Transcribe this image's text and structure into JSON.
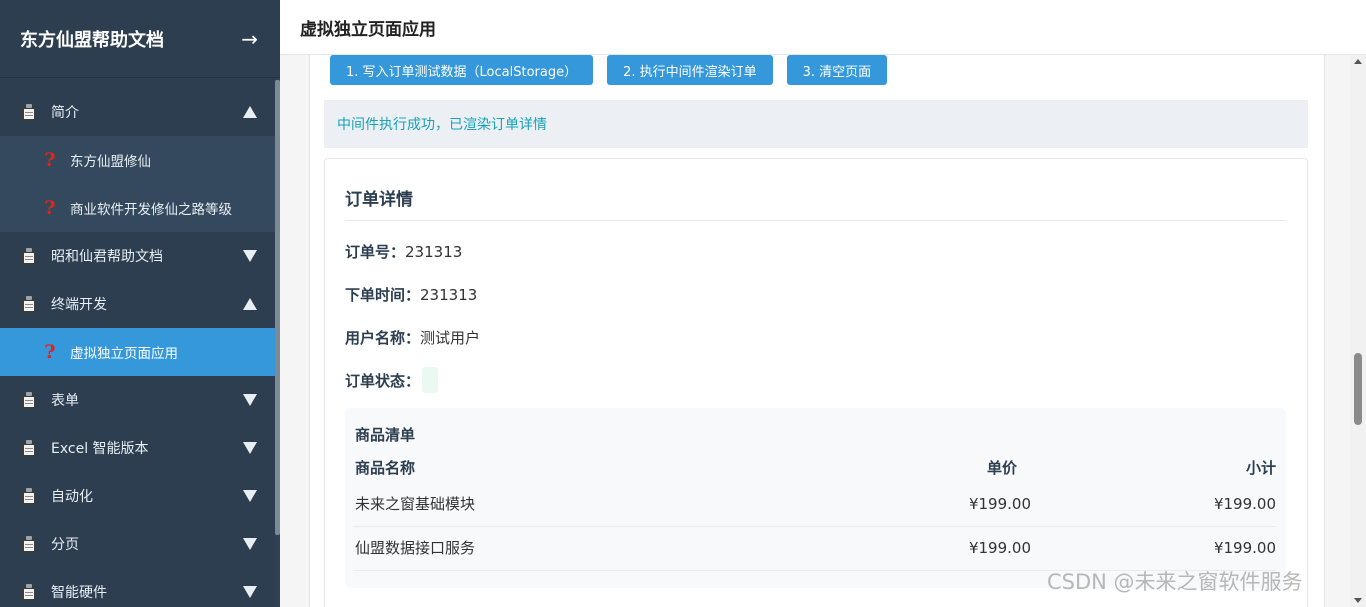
{
  "sidebar": {
    "title": "东方仙盟帮助文档",
    "collapse_icon": "→",
    "items": [
      {
        "label": "简介",
        "icon": "clipboard-icon",
        "expanded": true
      },
      {
        "label": "东方仙盟修仙",
        "icon": "question-icon",
        "child": true
      },
      {
        "label": "商业软件开发修仙之路等级",
        "icon": "question-icon",
        "child": true
      },
      {
        "label": "昭和仙君帮助文档",
        "icon": "clipboard-icon",
        "expanded": false
      },
      {
        "label": "终端开发",
        "icon": "clipboard-icon",
        "expanded": true
      },
      {
        "label": "虚拟独立页面应用",
        "icon": "question-icon",
        "child": true,
        "active": true
      },
      {
        "label": "表单",
        "icon": "clipboard-icon",
        "expanded": false
      },
      {
        "label": "Excel 智能版本",
        "icon": "clipboard-icon",
        "expanded": false
      },
      {
        "label": "自动化",
        "icon": "clipboard-icon",
        "expanded": false
      },
      {
        "label": "分页",
        "icon": "clipboard-icon",
        "expanded": false
      },
      {
        "label": "智能硬件",
        "icon": "clipboard-icon",
        "expanded": false
      }
    ]
  },
  "header": {
    "title": "虚拟独立页面应用"
  },
  "actions": {
    "write_label": "1. 写入订单测试数据（LocalStorage）",
    "render_label": "2. 执行中间件渲染订单",
    "clear_label": "3. 清空页面"
  },
  "alert": {
    "message": "中间件执行成功，已渲染订单详情"
  },
  "order": {
    "title": "订单详情",
    "id_label": "订单号：",
    "id_value": "231313",
    "time_label": "下单时间：",
    "time_value": "231313",
    "user_label": "用户名称：",
    "user_value": "测试用户",
    "status_label": "订单状态：",
    "status_value": ""
  },
  "goods": {
    "title": "商品清单",
    "columns": [
      "商品名称",
      "单价",
      "小计"
    ],
    "rows": [
      [
        "未来之窗基础模块",
        "¥199.00",
        "¥199.00"
      ],
      [
        "仙盟数据接口服务",
        "¥199.00",
        "¥199.00"
      ]
    ]
  },
  "watermark": "CSDN @未来之窗软件服务",
  "colors": {
    "sidebar_bg": "#2c3e50",
    "accent": "#3498db",
    "alert_text": "#17a2b8"
  }
}
